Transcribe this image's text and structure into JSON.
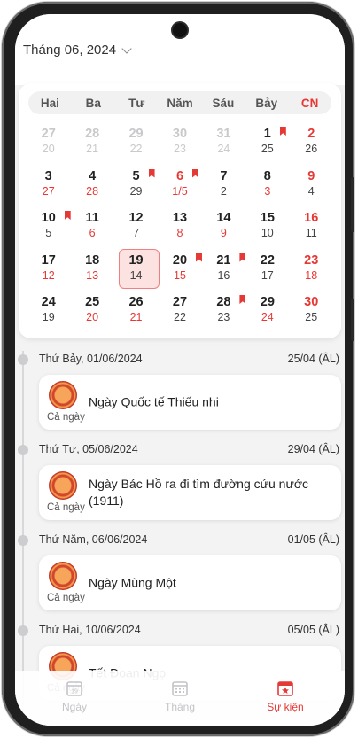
{
  "header": {
    "month_label": "Tháng 06, 2024"
  },
  "weekdays": [
    "Hai",
    "Ba",
    "Tư",
    "Năm",
    "Sáu",
    "Bảy",
    "CN"
  ],
  "weeks": [
    [
      {
        "solar": "27",
        "lunar": "20",
        "other": true
      },
      {
        "solar": "28",
        "lunar": "21",
        "other": true
      },
      {
        "solar": "29",
        "lunar": "22",
        "other": true
      },
      {
        "solar": "30",
        "lunar": "23",
        "other": true
      },
      {
        "solar": "31",
        "lunar": "24",
        "other": true
      },
      {
        "solar": "1",
        "lunar": "25",
        "flag": true
      },
      {
        "solar": "2",
        "lunar": "26"
      }
    ],
    [
      {
        "solar": "3",
        "lunar": "27",
        "lunar_red": true
      },
      {
        "solar": "4",
        "lunar": "28",
        "lunar_red": true
      },
      {
        "solar": "5",
        "lunar": "29",
        "flag": true
      },
      {
        "solar": "6",
        "lunar": "1/5",
        "lunar_red": true,
        "solar_red": true,
        "flag": true
      },
      {
        "solar": "7",
        "lunar": "2"
      },
      {
        "solar": "8",
        "lunar": "3",
        "lunar_red": true
      },
      {
        "solar": "9",
        "lunar": "4"
      }
    ],
    [
      {
        "solar": "10",
        "lunar": "5",
        "flag": true
      },
      {
        "solar": "11",
        "lunar": "6",
        "lunar_red": true
      },
      {
        "solar": "12",
        "lunar": "7"
      },
      {
        "solar": "13",
        "lunar": "8",
        "lunar_red": true
      },
      {
        "solar": "14",
        "lunar": "9",
        "lunar_red": true
      },
      {
        "solar": "15",
        "lunar": "10"
      },
      {
        "solar": "16",
        "lunar": "11"
      }
    ],
    [
      {
        "solar": "17",
        "lunar": "12",
        "lunar_red": true
      },
      {
        "solar": "18",
        "lunar": "13",
        "lunar_red": true
      },
      {
        "solar": "19",
        "lunar": "14",
        "today": true
      },
      {
        "solar": "20",
        "lunar": "15",
        "lunar_red": true,
        "flag": true
      },
      {
        "solar": "21",
        "lunar": "16",
        "flag": true
      },
      {
        "solar": "22",
        "lunar": "17"
      },
      {
        "solar": "23",
        "lunar": "18",
        "lunar_red": true
      }
    ],
    [
      {
        "solar": "24",
        "lunar": "19"
      },
      {
        "solar": "25",
        "lunar": "20",
        "lunar_red": true
      },
      {
        "solar": "26",
        "lunar": "21",
        "lunar_red": true
      },
      {
        "solar": "27",
        "lunar": "22"
      },
      {
        "solar": "28",
        "lunar": "23",
        "flag": true
      },
      {
        "solar": "29",
        "lunar": "24",
        "lunar_red": true
      },
      {
        "solar": "30",
        "lunar": "25"
      }
    ]
  ],
  "events": [
    {
      "date": "Thứ Bảy, 01/06/2024",
      "lunar": "25/04 (ÂL)",
      "title": "Ngày Quốc tế Thiếu nhi",
      "allday": "Cả ngày"
    },
    {
      "date": "Thứ Tư, 05/06/2024",
      "lunar": "29/04 (ÂL)",
      "title": "Ngày Bác Hồ ra đi tìm đường cứu nước (1911)",
      "allday": "Cả ngày"
    },
    {
      "date": "Thứ Năm, 06/06/2024",
      "lunar": "01/05 (ÂL)",
      "title": "Ngày Mùng Một",
      "allday": "Cả ngày"
    },
    {
      "date": "Thứ Hai, 10/06/2024",
      "lunar": "05/05 (ÂL)",
      "title": "Tết Đoan Ngọ",
      "allday": "Cả ngày"
    }
  ],
  "nav": {
    "items": [
      {
        "label": "Ngày",
        "icon": "calendar-day-icon",
        "active": false
      },
      {
        "label": "Tháng",
        "icon": "calendar-month-icon",
        "active": false
      },
      {
        "label": "Sự kiện",
        "icon": "calendar-star-icon",
        "active": true
      }
    ]
  },
  "colors": {
    "accent": "#e53935",
    "today_bg": "#fde2e2"
  }
}
